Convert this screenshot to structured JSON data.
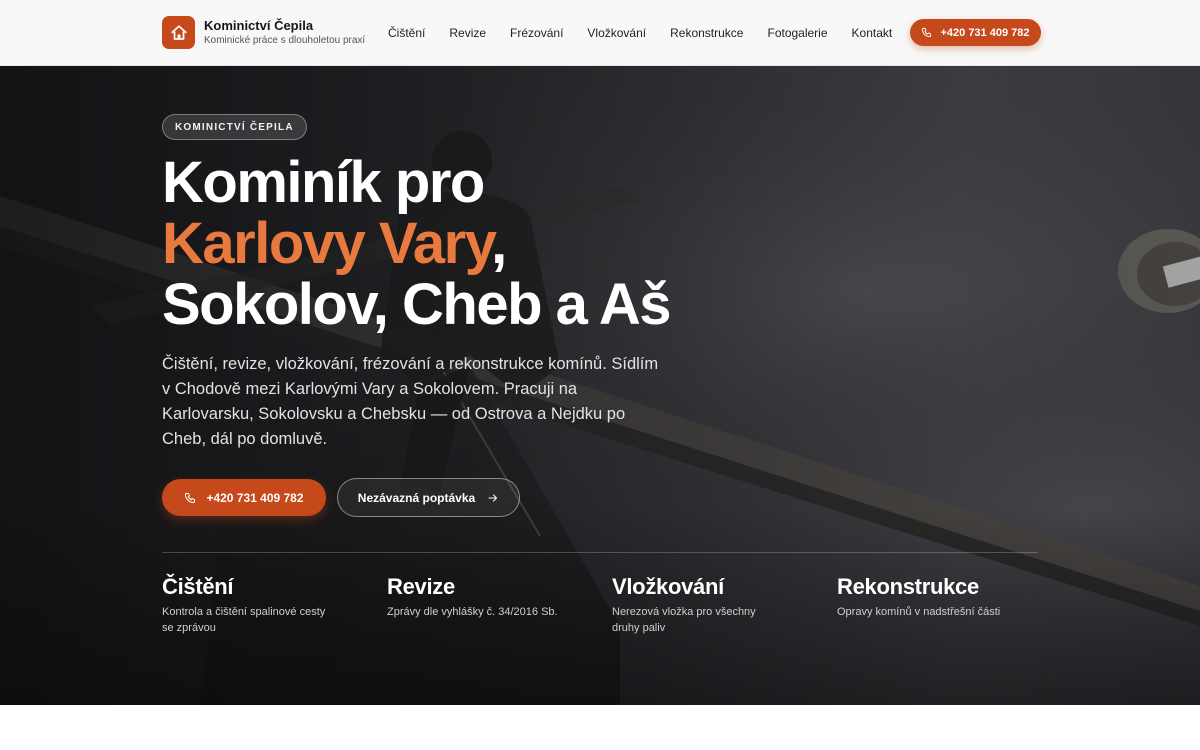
{
  "colors": {
    "accent": "#c5491b",
    "accent_light": "#e8793f",
    "header_bg": "#f8f8f8"
  },
  "brand": {
    "name": "Kominictví Čepila",
    "tagline": "Kominické práce s dlouholetou praxí",
    "logo_icon": "home-icon"
  },
  "nav": {
    "items": [
      {
        "label": "Čištění"
      },
      {
        "label": "Revize"
      },
      {
        "label": "Frézování"
      },
      {
        "label": "Vložkování"
      },
      {
        "label": "Rekonstrukce"
      },
      {
        "label": "Fotogalerie"
      },
      {
        "label": "Kontakt"
      }
    ],
    "cta_phone": "+420 731 409 782"
  },
  "hero": {
    "eyebrow": "KOMINICTVÍ ČEPILA",
    "title_line1": "Kominík pro",
    "title_accent": "Karlovy Vary",
    "title_comma": ",",
    "title_line3": "Sokolov, Cheb a Aš",
    "lead": "Čištění, revize, vložkování, frézování a rekonstrukce komínů. Sídlím v Chodově mezi Karlovými Vary a Sokolovem. Pracuji na Karlovarsku, Sokolovsku a Chebsku — od Ostrova a Nejdku po Cheb, dál po domluvě.",
    "primary_button": "+420 731 409 782",
    "secondary_button": "Nezávazná poptávka"
  },
  "services": [
    {
      "title": "Čištění",
      "desc": "Kontrola a čištění spalinové cesty se zprávou"
    },
    {
      "title": "Revize",
      "desc": "Zprávy dle vyhlášky č. 34/2016 Sb."
    },
    {
      "title": "Vložkování",
      "desc": "Nerezová vložka pro všechny druhy paliv"
    },
    {
      "title": "Rekonstrukce",
      "desc": "Opravy komínů v nadstřešní části"
    }
  ]
}
